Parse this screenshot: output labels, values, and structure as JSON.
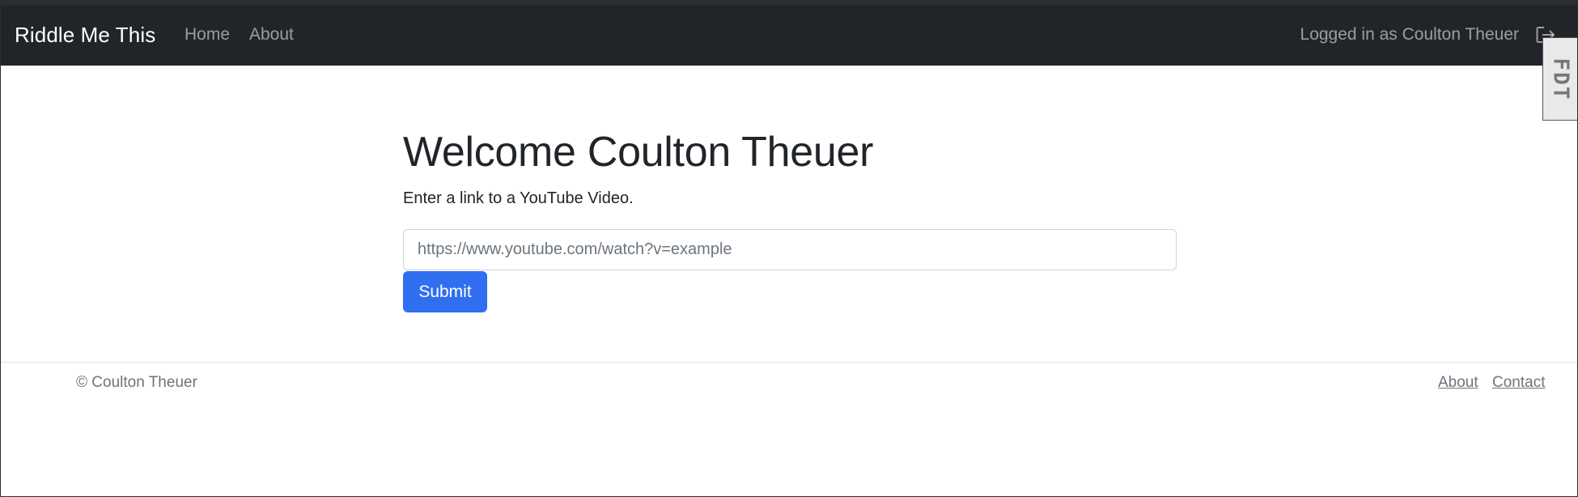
{
  "navbar": {
    "brand": "Riddle Me This",
    "links": [
      {
        "label": "Home"
      },
      {
        "label": "About"
      }
    ],
    "login_status": "Logged in as Coulton Theuer",
    "logout_icon": "box-arrow-right-icon"
  },
  "side_tab": {
    "label": "FDT"
  },
  "main": {
    "title": "Welcome Coulton Theuer",
    "subtitle": "Enter a link to a YouTube Video.",
    "url_input": {
      "value": "",
      "placeholder": "https://www.youtube.com/watch?v=example"
    },
    "submit_label": "Submit"
  },
  "footer": {
    "copyright": "© Coulton Theuer",
    "links": [
      {
        "label": "About"
      },
      {
        "label": "Contact"
      }
    ]
  },
  "colors": {
    "navbar_bg": "#212529",
    "primary": "#2f6ff0",
    "muted_text": "#6c757d"
  }
}
